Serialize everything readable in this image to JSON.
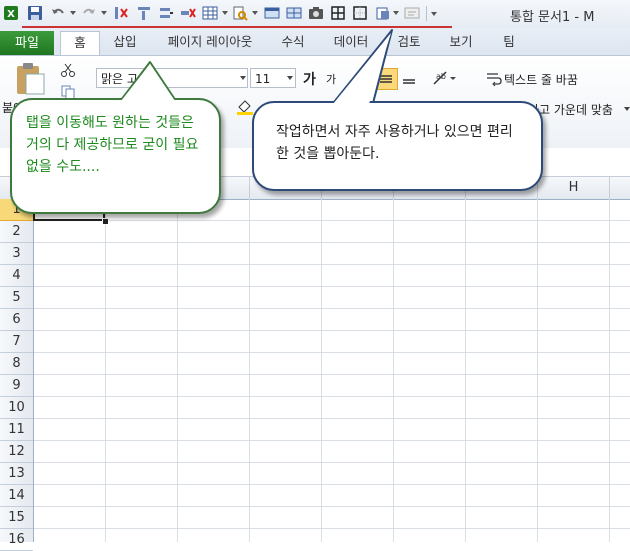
{
  "window": {
    "title": "통합 문서1 - M"
  },
  "tabs": {
    "file": "파일",
    "home": "홈",
    "insert": "삽입",
    "page_layout": "페이지 레이아웃",
    "formulas": "수식",
    "data": "데이터",
    "review": "검토",
    "view": "보기",
    "team": "팀"
  },
  "ribbon": {
    "font_name": "맑은 고",
    "font_size": "11",
    "font_grow": "가",
    "font_shrink": "가",
    "paste_label": "붙여",
    "wrap_text": "텍스트 줄 바꿈",
    "merge_center": "하고 가운데 맞춤"
  },
  "grid": {
    "columns": [
      "",
      "",
      "",
      "",
      "",
      "",
      "",
      "H",
      ""
    ],
    "rows": [
      "1",
      "2",
      "3",
      "4",
      "5",
      "6",
      "7",
      "8",
      "9",
      "10",
      "11",
      "12",
      "13",
      "14",
      "15",
      "16"
    ]
  },
  "callouts": {
    "left": "탭을 이동해도 원하는 것들은 거의 다 제공하므로 굳이 필요없을 수도....",
    "right": "작업하면서 자주 사용하거나 있으면 편리한 것을 뽑아둔다."
  },
  "colors": {
    "file_tab": "#207520",
    "callout_left_border": "#3e7a3e",
    "callout_left_text": "#1e8a1e",
    "callout_right_border": "#2d4a78",
    "qat_underline": "#cc3333"
  }
}
